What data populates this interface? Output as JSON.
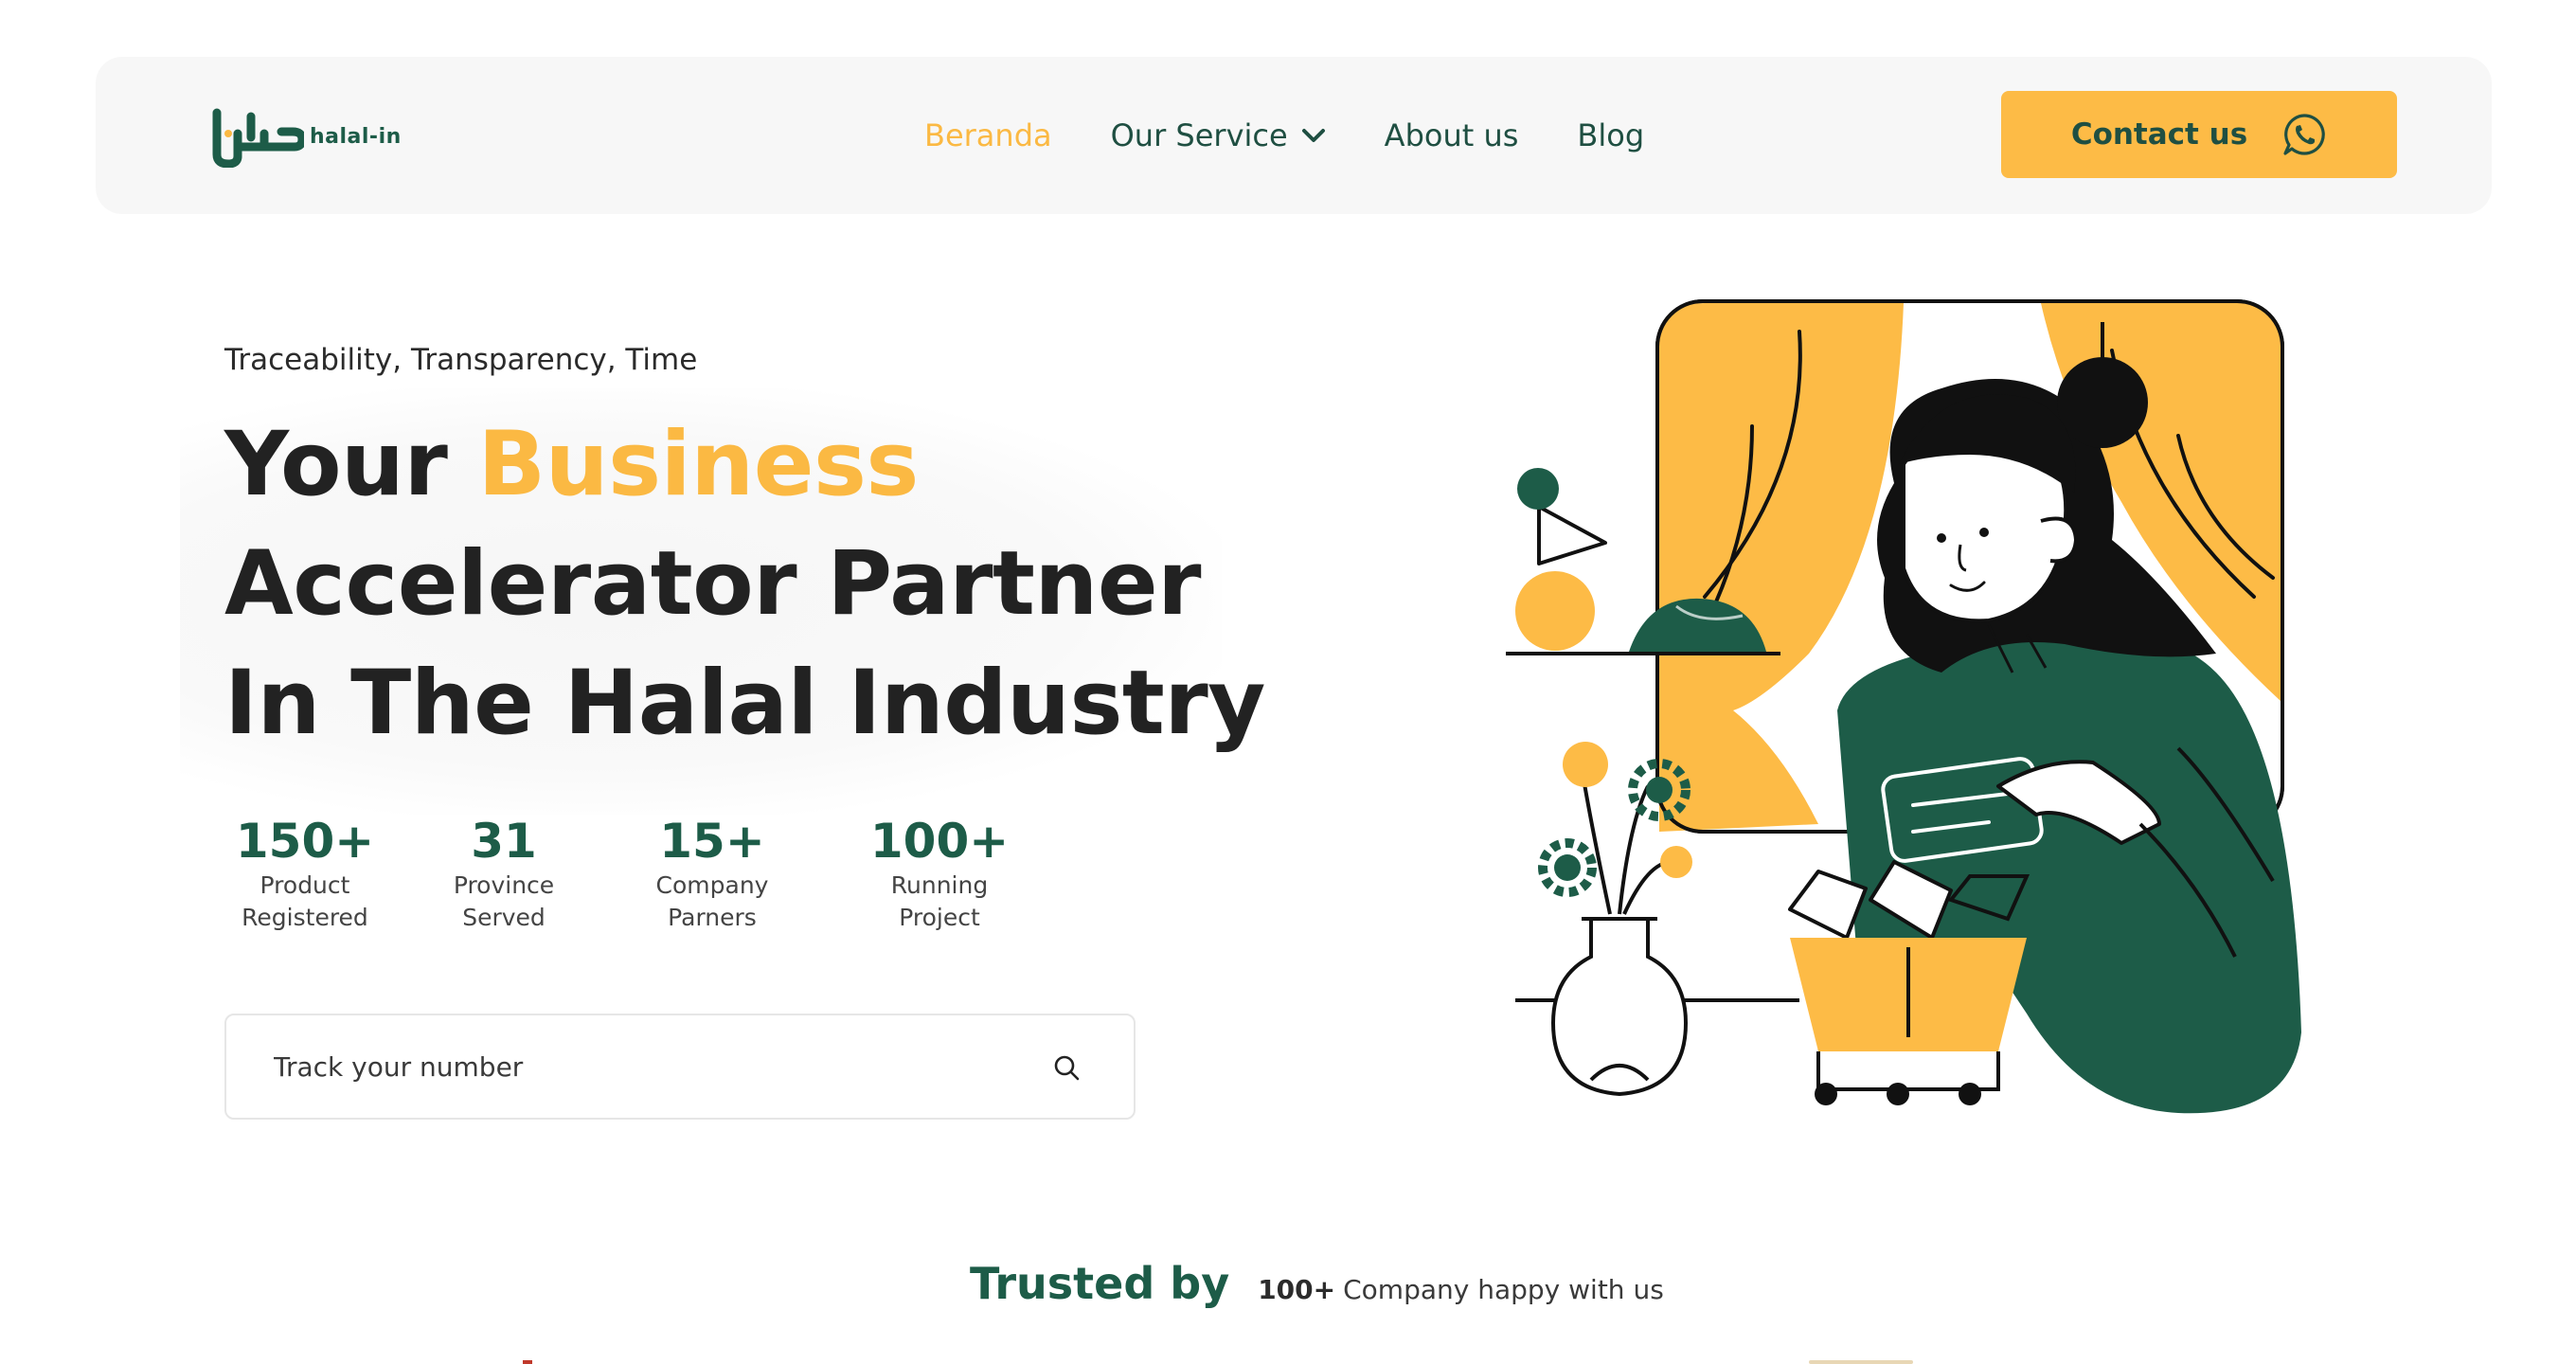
{
  "brand": {
    "logo_text": "halal-in",
    "logo_icon": "halal-arabic-logo-icon"
  },
  "nav": {
    "items": [
      {
        "label": "Beranda",
        "active": true
      },
      {
        "label": "Our Service",
        "has_dropdown": true
      },
      {
        "label": "About us"
      },
      {
        "label": "Blog"
      }
    ],
    "contact_label": "Contact us",
    "contact_icon": "whatsapp-icon"
  },
  "hero": {
    "tagline": "Traceability, Transparency, Time",
    "headline_1": "Your ",
    "headline_accent": "Business",
    "headline_2": "Accelerator Partner",
    "headline_3": "In The Halal Industry",
    "stats": [
      {
        "value": "150+",
        "label_1": "Product",
        "label_2": "Registered"
      },
      {
        "value": "31",
        "label_1": "Province",
        "label_2": "Served"
      },
      {
        "value": "15+",
        "label_1": "Company",
        "label_2": "Parners"
      },
      {
        "value": "100+",
        "label_1": "Running",
        "label_2": "Project"
      }
    ],
    "search_placeholder": "Track your number",
    "search_icon": "search-icon",
    "illustration": "woman-holding-card-with-shopping-basket-illustration"
  },
  "trusted": {
    "title": "Trusted by",
    "count": "100+",
    "text": "Company happy with us"
  },
  "colors": {
    "accent": "#fbb943",
    "brand_green": "#1d5c48",
    "nav_bg": "#f7f7f7"
  }
}
